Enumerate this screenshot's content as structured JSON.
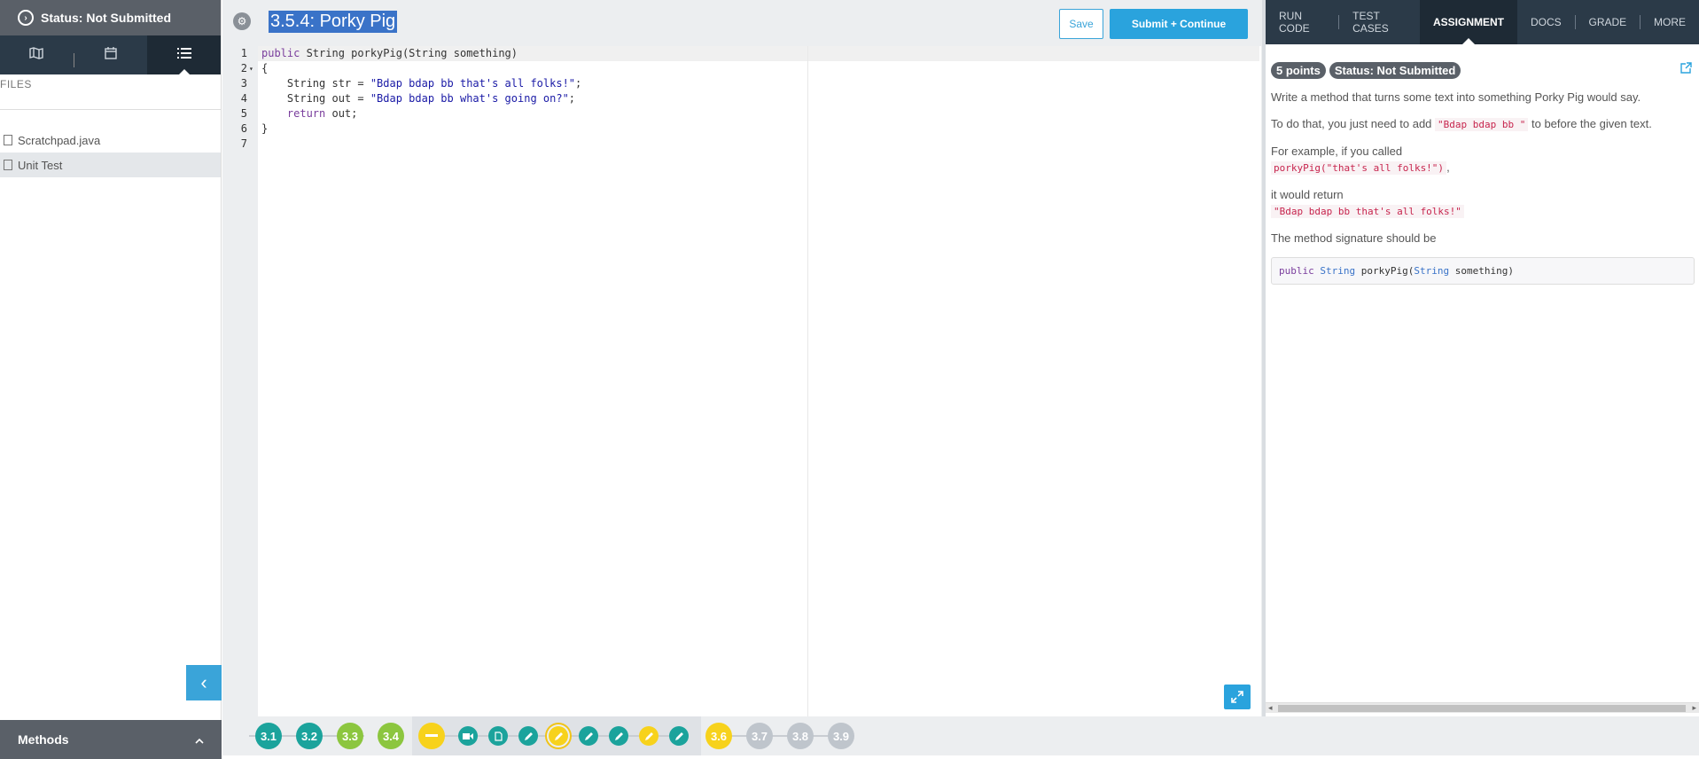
{
  "sidebar": {
    "status_label": "Status: Not Submitted",
    "files_heading": "FILES",
    "files": [
      {
        "name": "Scratchpad.java",
        "selected": false
      },
      {
        "name": "Unit Test",
        "selected": true
      }
    ],
    "methods_label": "Methods"
  },
  "editor": {
    "title": "3.5.4: Porky Pig",
    "save_label": "Save",
    "submit_label": "Submit + Continue",
    "line_numbers": [
      "1",
      "2",
      "3",
      "4",
      "5",
      "6",
      "7"
    ],
    "code": {
      "l1_kw": "public",
      "l1_rest": " String porkyPig(String something)",
      "l2": "{",
      "l3_pre": "    String str = ",
      "l3_str": "\"Bdap bdap bb that's all folks!\"",
      "l3_post": ";",
      "l4_pre": "    String out = ",
      "l4_str": "\"Bdap bdap bb what's going on?\"",
      "l4_post": ";",
      "l5_kw": "    return",
      "l5_rest": " out;",
      "l6": "}",
      "l7": ""
    }
  },
  "right_panel": {
    "tabs": [
      "RUN CODE",
      "TEST CASES",
      "ASSIGNMENT",
      "DOCS",
      "GRADE",
      "MORE"
    ],
    "active_tab": "ASSIGNMENT",
    "badge_points": "5 points",
    "badge_status": "Status: Not Submitted",
    "p1": "Write a method that turns some text into something Porky Pig would say.",
    "p2_pre": "To do that, you just need to add ",
    "p2_code": "\"Bdap bdap bb \"",
    "p2_post": " to before the given text.",
    "p3": "For example, if you called",
    "p3_code": "porkyPig(\"that's all folks!\")",
    "p3_post": ",",
    "p4": "it would return",
    "p4_code": "\"Bdap bdap bb that's all folks!\"",
    "p5": "The method signature should be",
    "sig_kw": "public",
    "sig_type1": "String",
    "sig_mid": " porkyPig(",
    "sig_type2": "String",
    "sig_end": " something)"
  },
  "progress": {
    "nodes": [
      "3.1",
      "3.2",
      "3.3",
      "3.4",
      "3.6",
      "3.7",
      "3.8",
      "3.9"
    ]
  },
  "colors": {
    "accent": "#2aa3dd",
    "sidebar_dark": "#2b3a48",
    "status_gray": "#5a6068",
    "teal": "#1ba39c",
    "green": "#8cc63f",
    "yellow": "#f7d21c"
  }
}
